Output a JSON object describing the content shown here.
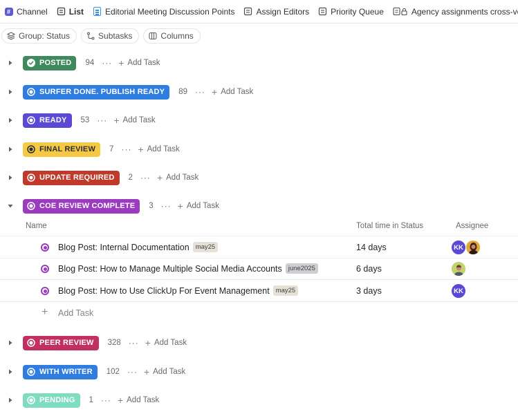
{
  "tabs": [
    {
      "label": "Channel",
      "icon": "hash-icon"
    },
    {
      "label": "List",
      "icon": "list-icon",
      "active": true
    },
    {
      "label": "Editorial Meeting Discussion Points",
      "icon": "doc-icon"
    },
    {
      "label": "Assign Editors",
      "icon": "list-icon"
    },
    {
      "label": "Priority Queue",
      "icon": "list-icon"
    },
    {
      "label": "Agency assignments cross-ve",
      "icon": "lock-list-icon"
    }
  ],
  "toolbar": {
    "group_label": "Group: Status",
    "subtasks_label": "Subtasks",
    "columns_label": "Columns"
  },
  "add_task_label": "Add Task",
  "more_label": "···",
  "groups": [
    {
      "name": "POSTED",
      "count": "94",
      "color": "#3f8a5c",
      "text_color": "#ffffff",
      "icon": "check-circle-icon",
      "expanded": false
    },
    {
      "name": "SURFER DONE. PUBLISH READY",
      "count": "89",
      "color": "#2f7de1",
      "text_color": "#ffffff",
      "icon": "status-circle-icon",
      "expanded": false
    },
    {
      "name": "READY",
      "count": "53",
      "color": "#5b49d6",
      "text_color": "#ffffff",
      "icon": "status-circle-icon",
      "expanded": false
    },
    {
      "name": "FINAL REVIEW",
      "count": "7",
      "color": "#f5c944",
      "text_color": "#2a2e34",
      "icon": "status-circle-icon",
      "expanded": false
    },
    {
      "name": "UPDATE REQUIRED",
      "count": "2",
      "color": "#c0392b",
      "text_color": "#ffffff",
      "icon": "status-circle-icon",
      "expanded": false
    },
    {
      "name": "COE REVIEW COMPLETE",
      "count": "3",
      "color": "#9b3bbf",
      "text_color": "#ffffff",
      "icon": "status-circle-icon",
      "expanded": true
    },
    {
      "name": "PEER REVIEW",
      "count": "328",
      "color": "#c2305f",
      "text_color": "#ffffff",
      "icon": "status-circle-icon",
      "expanded": false
    },
    {
      "name": "WITH WRITER",
      "count": "102",
      "color": "#2f7de1",
      "text_color": "#ffffff",
      "icon": "status-circle-icon",
      "expanded": false
    },
    {
      "name": "PENDING",
      "count": "1",
      "color": "#7fdcc0",
      "text_color": "#ffffff",
      "icon": "status-circle-icon",
      "expanded": false
    }
  ],
  "table": {
    "columns": [
      "Name",
      "Total time in Status",
      "Assignee"
    ],
    "rows": [
      {
        "name": "Blog Post: Internal Documentation",
        "tag": "may25",
        "tag_color": "#e6e0d6",
        "time": "14 days",
        "assignees": [
          {
            "initials": "KK",
            "color": "#5b49d6"
          },
          {
            "initials": "",
            "color": "#6b3b2a",
            "photo": true
          }
        ]
      },
      {
        "name": "Blog Post: How to Manage Multiple Social Media Accounts",
        "tag": "june2025",
        "tag_color": "#cfcfd2",
        "time": "6 days",
        "assignees": [
          {
            "initials": "",
            "color": "#b8c96a",
            "photo": true
          }
        ]
      },
      {
        "name": "Blog Post: How to Use ClickUp For Event Management",
        "tag": "may25",
        "tag_color": "#e6e0d6",
        "time": "3 days",
        "assignees": [
          {
            "initials": "KK",
            "color": "#5b49d6"
          }
        ]
      }
    ],
    "add_task_label": "Add Task"
  }
}
